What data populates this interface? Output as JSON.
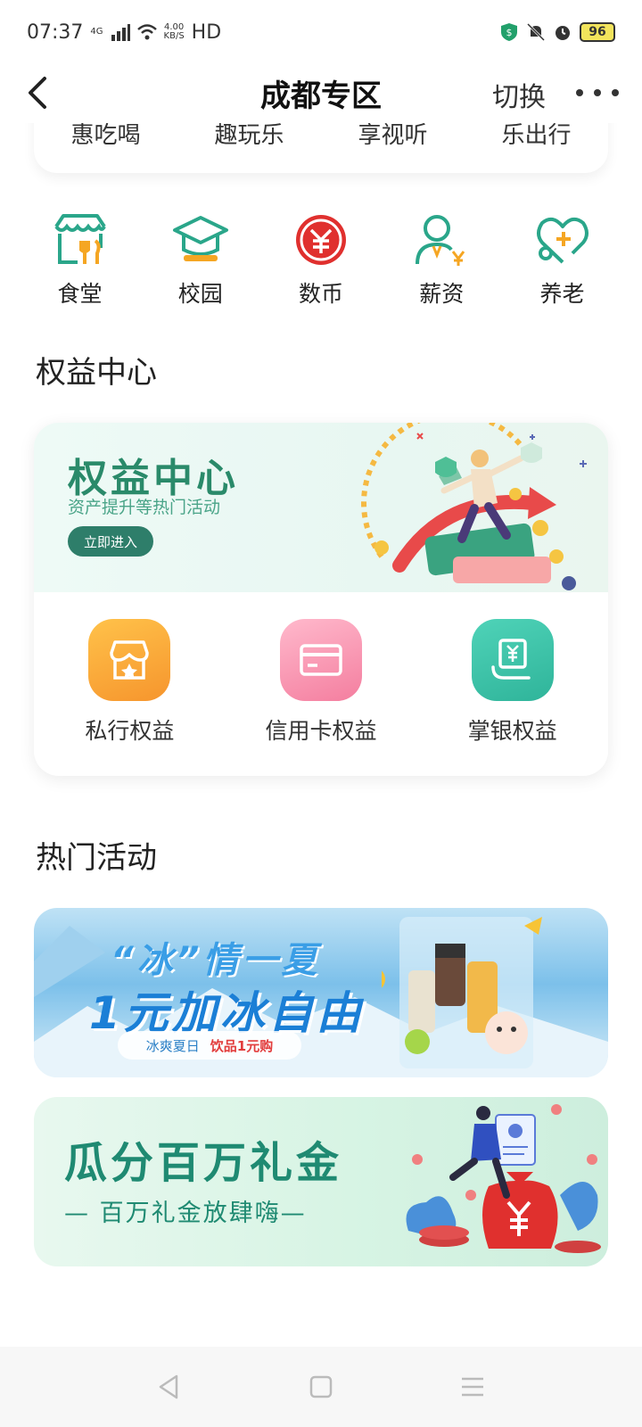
{
  "status": {
    "time": "07:37",
    "network": "4G",
    "speed_value": "4.00",
    "speed_unit": "KB/S",
    "hd": "HD",
    "battery": "96"
  },
  "header": {
    "title": "成都专区",
    "switch_label": "切换"
  },
  "tabs": [
    {
      "label": "惠吃喝"
    },
    {
      "label": "趣玩乐"
    },
    {
      "label": "享视听"
    },
    {
      "label": "乐出行"
    }
  ],
  "services": [
    {
      "label": "食堂",
      "icon": "canteen-icon"
    },
    {
      "label": "校园",
      "icon": "campus-icon"
    },
    {
      "label": "数币",
      "icon": "digital-yuan-icon"
    },
    {
      "label": "薪资",
      "icon": "salary-icon"
    },
    {
      "label": "养老",
      "icon": "pension-icon"
    }
  ],
  "rights_section": {
    "title": "权益中心",
    "banner_title": "权益中心",
    "banner_subtitle": "资产提升等热门活动",
    "banner_button": "立即进入",
    "items": [
      {
        "label": "私行权益",
        "icon": "private-bank-icon"
      },
      {
        "label": "信用卡权益",
        "icon": "credit-card-icon"
      },
      {
        "label": "掌银权益",
        "icon": "mobile-bank-icon"
      }
    ]
  },
  "activity_section": {
    "title": "热门活动",
    "ice_banner": {
      "line1": "“冰”情一夏",
      "line2": "1元加冰自由",
      "pill_left": "冰爽夏日",
      "pill_right": "饮品1元购"
    },
    "gold_banner": {
      "title": "瓜分百万礼金",
      "subtitle": "— 百万礼金放肆嗨—"
    }
  },
  "colors": {
    "brand_green": "#2a8a6a",
    "accent_red": "#e0302e",
    "accent_orange": "#f6952d"
  }
}
